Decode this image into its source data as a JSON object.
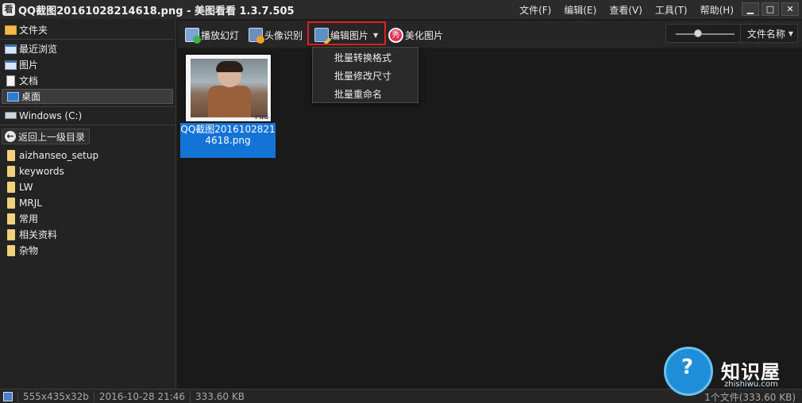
{
  "window": {
    "app_icon_glyph": "看",
    "title": "QQ截图20161028214618.png - 美图看看 1.3.7.505",
    "minimize_glyph": "▁",
    "maximize_glyph": "□",
    "close_glyph": "✕"
  },
  "menu": [
    "文件(F)",
    "编辑(E)",
    "查看(V)",
    "工具(T)",
    "帮助(H)"
  ],
  "sidebar": {
    "root": "文件夹",
    "items": [
      {
        "label": "最近浏览",
        "icon": "recent-window-icon"
      },
      {
        "label": "图片",
        "icon": "pictures-window-icon"
      },
      {
        "label": "文档",
        "icon": "document-icon"
      },
      {
        "label": "桌面",
        "icon": "desktop-icon",
        "selected": true
      }
    ],
    "drive": "Windows (C:)",
    "back_label": "返回上一级目录",
    "subfolders": [
      "aizhanseo_setup",
      "keywords",
      "LW",
      "MRJL",
      "常用",
      "相关资料",
      "杂物"
    ]
  },
  "toolbar": {
    "slideshow": "播放幻灯",
    "face": "头像识别",
    "edit": "编辑图片",
    "edit_caret": "▼",
    "beauty": "美化图片",
    "beauty_icon_glyph": "秀",
    "sort": "文件名称",
    "sort_caret": "▼"
  },
  "edit_dropdown": [
    "批量转换格式",
    "批量修改尺寸",
    "批量重命名"
  ],
  "thumbnail": {
    "name": "QQ截图20161028214618.png",
    "badge": "PNG"
  },
  "statusbar": {
    "dimensions": "555x435x32b",
    "date": "2016-10-28 21:46",
    "size": "333.60 KB",
    "right": "1个文件(333.60 KB)"
  },
  "watermark": {
    "glyph": "?",
    "title": "知识屋",
    "subtitle": "zhishiwu.com"
  },
  "colors": {
    "selection_blue": "#1473d6",
    "highlight_red": "#e02020",
    "background": "#1b1b1b"
  }
}
